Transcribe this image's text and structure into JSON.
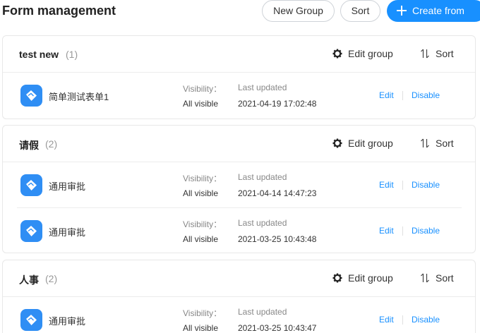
{
  "header": {
    "title": "Form management",
    "new_group_label": "New Group",
    "sort_label": "Sort",
    "create_label": "Create from"
  },
  "group_actions": {
    "edit_group_label": "Edit group",
    "sort_label": "Sort"
  },
  "labels": {
    "visibility": "Visibility：",
    "last_updated": "Last updated",
    "edit": "Edit",
    "disable": "Disable"
  },
  "groups": [
    {
      "name": "test new",
      "count": "(1)",
      "forms": [
        {
          "name": "简单测试表单1",
          "visibility": "All visible",
          "updated": "2021-04-19 17:02:48"
        }
      ]
    },
    {
      "name": "请假",
      "count": "(2)",
      "forms": [
        {
          "name": "通用审批",
          "visibility": "All visible",
          "updated": "2021-04-14 14:47:23"
        },
        {
          "name": "通用审批",
          "visibility": "All visible",
          "updated": "2021-03-25 10:43:48"
        }
      ]
    },
    {
      "name": "人事",
      "count": "(2)",
      "forms": [
        {
          "name": "通用审批",
          "visibility": "All visible",
          "updated": "2021-03-25 10:43:47"
        }
      ]
    }
  ],
  "colors": {
    "accent": "#1890ff",
    "form_icon": "#2f8ef4",
    "muted_text": "#999999"
  },
  "icons": {
    "create": "plus-icon",
    "edit_group": "gear-icon",
    "sort": "sort-arrows-icon",
    "form": "form-tag-icon"
  }
}
